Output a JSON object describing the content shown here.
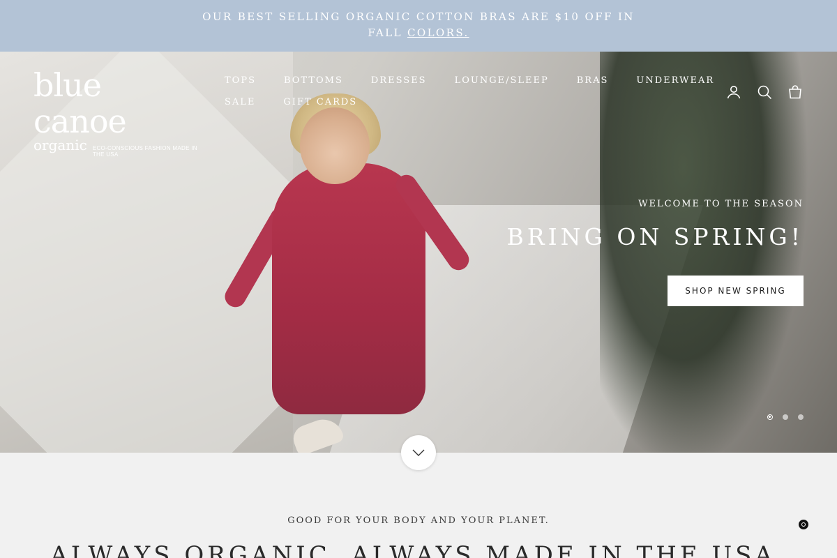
{
  "announcement": {
    "line1": "OUR BEST SELLING ORGANIC COTTON BRAS ARE $10 OFF IN",
    "line2_prefix": "FALL ",
    "line2_link": "COLORS."
  },
  "logo": {
    "brand": "blue canoe",
    "organic": "organic",
    "tagline": "ECO-CONSCIOUS FASHION MADE IN THE USA"
  },
  "nav": {
    "row1": [
      "TOPS",
      "BOTTOMS",
      "DRESSES",
      "LOUNGE/SLEEP",
      "BRAS",
      "UNDERWEAR"
    ],
    "row2": [
      "SALE",
      "GIFT CARDS"
    ]
  },
  "header_icons": [
    "account-icon",
    "search-icon",
    "cart-icon"
  ],
  "hero": {
    "eyebrow": "WELCOME TO THE SEASON",
    "title": "BRING ON SPRING!",
    "button": "SHOP NEW SPRING",
    "slides_count": 3,
    "active_slide": 1
  },
  "section": {
    "eyebrow": "GOOD FOR YOUR BODY AND YOUR PLANET.",
    "title": "ALWAYS ORGANIC. ALWAYS MADE IN THE USA."
  },
  "colors": {
    "announcement_bg": "#b3c3d6",
    "page_bg": "#f1f1f1",
    "dress": "#a32c45"
  }
}
